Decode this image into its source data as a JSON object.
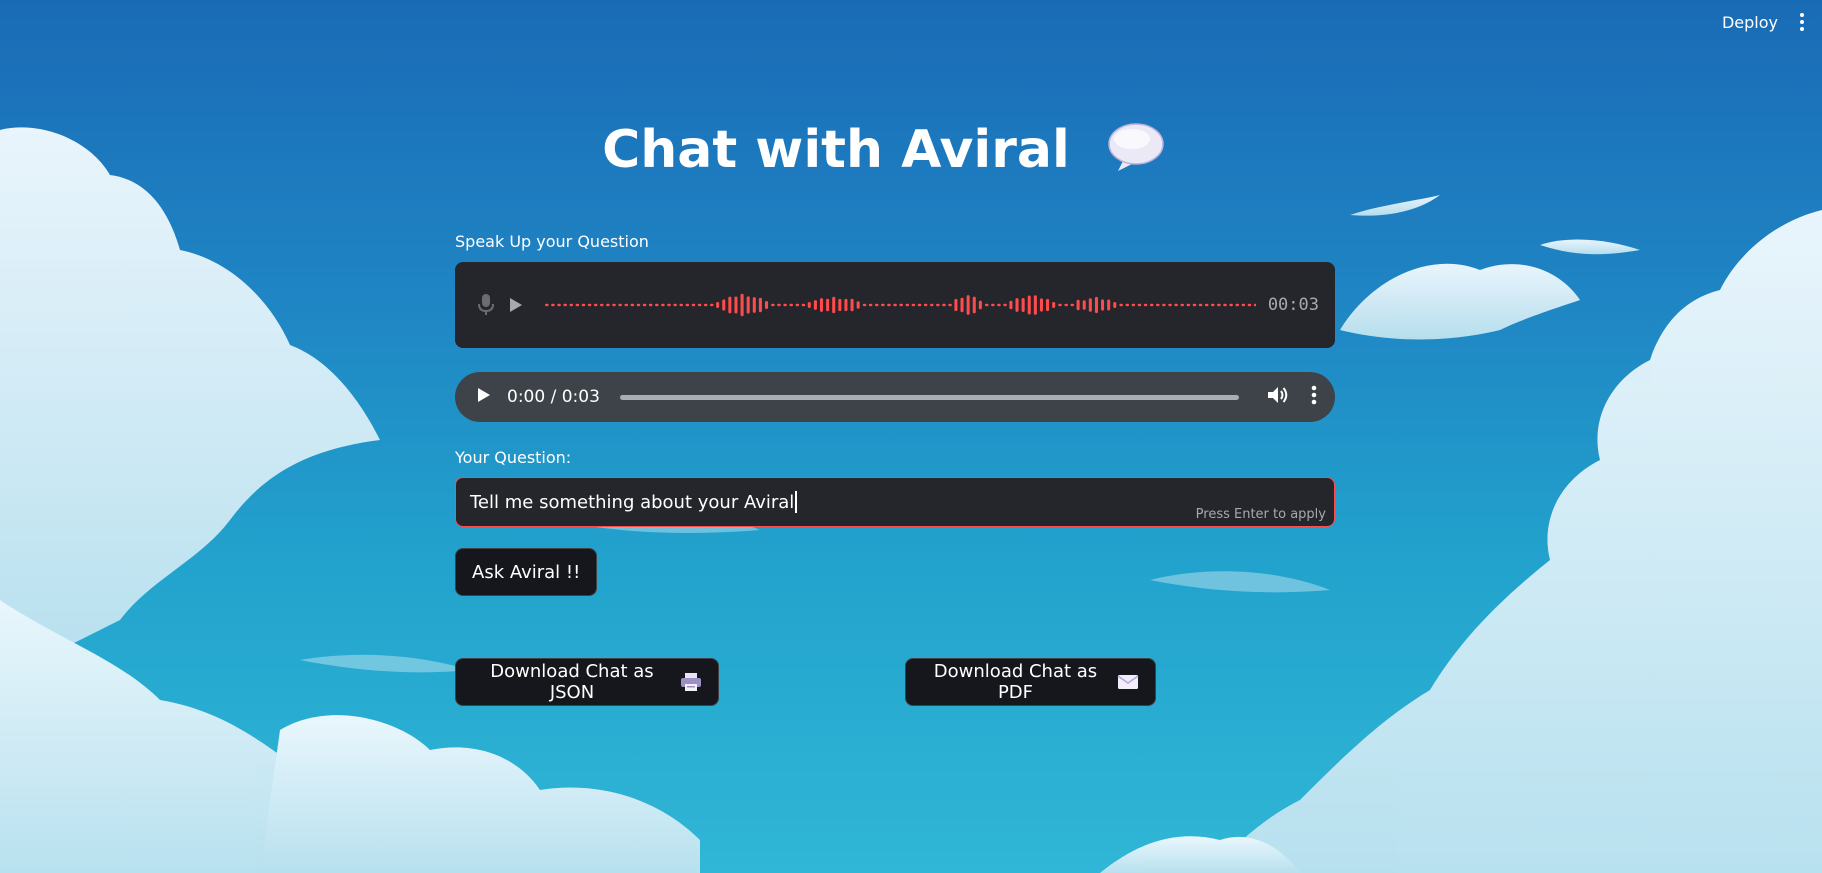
{
  "header": {
    "deploy_label": "Deploy"
  },
  "page": {
    "title": "Chat with Aviral",
    "title_icon": "speech-bubble-icon"
  },
  "voice": {
    "label": "Speak Up your Question",
    "timer": "00:03",
    "accent_color": "#ff4b4b"
  },
  "audio_player": {
    "time_display": "0:00 / 0:03"
  },
  "question": {
    "label": "Your Question:",
    "value": "Tell me something about your Aviral",
    "hint": "Press Enter to apply"
  },
  "actions": {
    "ask_label": "Ask Aviral !!",
    "download_json_label": "Download Chat as JSON",
    "download_json_icon": "printer-icon",
    "download_pdf_label": "Download Chat as PDF",
    "download_pdf_icon": "envelope-icon"
  }
}
